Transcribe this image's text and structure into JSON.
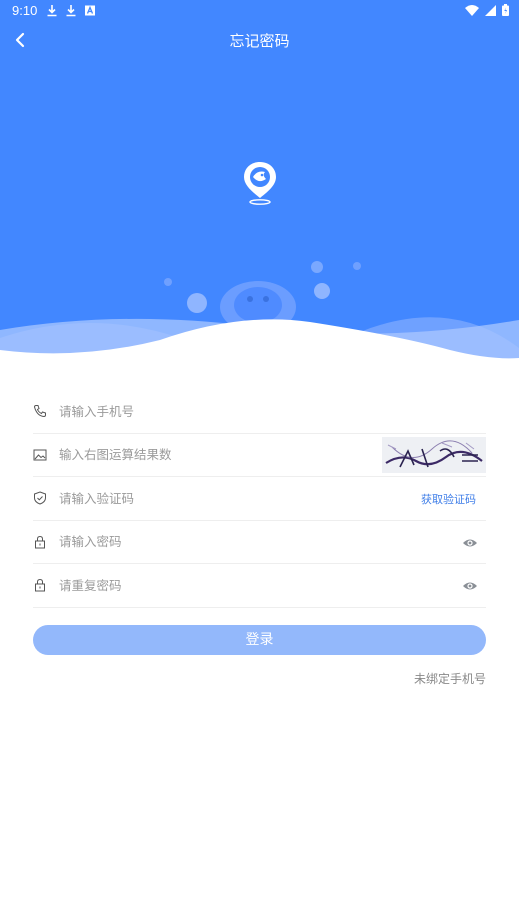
{
  "status_bar": {
    "time": "9:10",
    "icons": [
      "download-icon",
      "download-icon",
      "font-a-icon",
      "wifi-icon",
      "cell-signal-icon",
      "battery-icon"
    ]
  },
  "header": {
    "title": "忘记密码",
    "back_icon": "chevron-left-icon"
  },
  "colors": {
    "primary": "#4287ff",
    "button": "#93b8fb",
    "link": "#3f7ee8",
    "placeholder": "#9a9a9a"
  },
  "form": {
    "phone": {
      "placeholder": "请输入手机号",
      "icon": "phone-icon"
    },
    "captcha": {
      "placeholder": "输入右图运算结果数",
      "icon": "image-icon"
    },
    "code": {
      "placeholder": "请输入验证码",
      "icon": "shield-icon",
      "action_label": "获取验证码"
    },
    "password": {
      "placeholder": "请输入密码",
      "icon": "lock-icon",
      "toggle_icon": "eye-icon"
    },
    "confirm_password": {
      "placeholder": "请重复密码",
      "icon": "lock-icon",
      "toggle_icon": "eye-icon"
    }
  },
  "login_button": {
    "label": "登录"
  },
  "unbound_link": {
    "label": "未绑定手机号"
  }
}
